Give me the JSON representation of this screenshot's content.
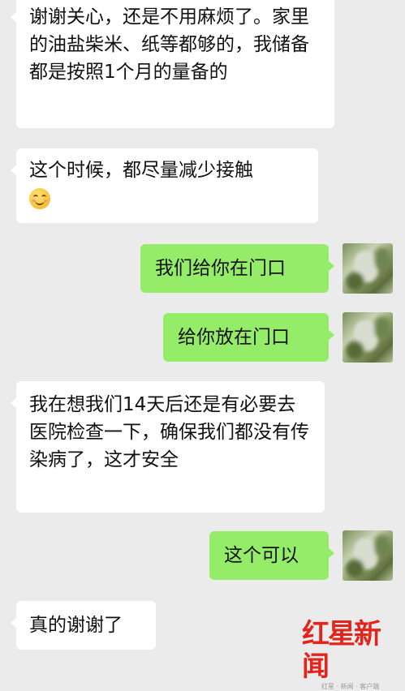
{
  "chat": {
    "messages": [
      {
        "side": "in",
        "text": "谢谢关心，还是不用麻烦了。家里的油盐柴米、纸等都够的，我储备都是按照1个月的量备的"
      },
      {
        "side": "in",
        "text": "这个时候，都尽量减少接触",
        "emoji": "smile-emoji"
      },
      {
        "side": "out",
        "text": "我们给你在门口"
      },
      {
        "side": "out",
        "text": "给你放在门口"
      },
      {
        "side": "in",
        "text": "我在想我们14天后还是有必要去医院检查一下，确保我们都没有传染病了，这才安全"
      },
      {
        "side": "out",
        "text": "这个可以"
      },
      {
        "side": "in",
        "text": "真的谢谢了"
      }
    ]
  },
  "watermark": {
    "text": "红星新闻",
    "sub": "红星 · 新闻 · 客户端"
  },
  "colors": {
    "background": "#ebebeb",
    "incoming_bubble": "#ffffff",
    "outgoing_bubble": "#95ec69",
    "watermark_red": "#e1241c"
  }
}
